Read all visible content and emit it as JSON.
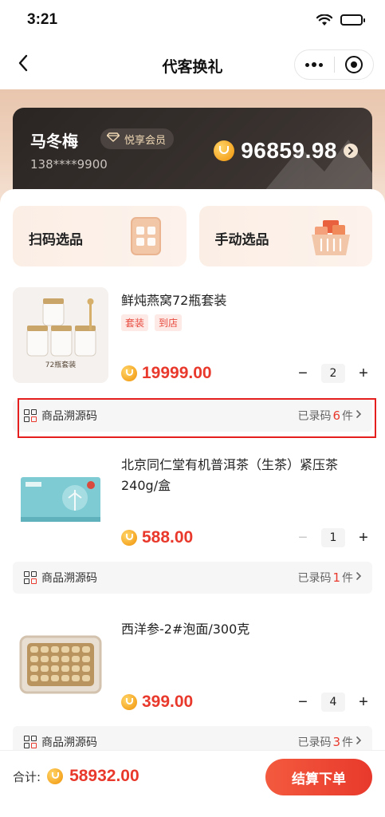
{
  "status_bar": {
    "time": "3:21"
  },
  "nav": {
    "title": "代客换礼"
  },
  "member": {
    "name": "马冬梅",
    "badge": "悦享会员",
    "phone": "138****9900",
    "balance": "96859.98"
  },
  "select_options": [
    {
      "label": "扫码选品",
      "icon": "scan-panel-icon"
    },
    {
      "label": "手动选品",
      "icon": "basket-icon"
    }
  ],
  "products": [
    {
      "name": "鲜炖燕窝72瓶套装",
      "tags": [
        "套装",
        "到店"
      ],
      "price": "19999.00",
      "quantity": "2",
      "thumb_caption": "72瓶套装",
      "trace_label": "商品溯源码",
      "trace_prefix": "已录码",
      "trace_count": "6",
      "trace_suffix": "件",
      "minus_disabled": false
    },
    {
      "name": "北京同仁堂有机普洱茶（生茶）紧压茶240g/盒",
      "tags": [],
      "price": "588.00",
      "quantity": "1",
      "trace_label": "商品溯源码",
      "trace_prefix": "已录码",
      "trace_count": "1",
      "trace_suffix": "件",
      "minus_disabled": true
    },
    {
      "name": "西洋参-2#泡面/300克",
      "tags": [],
      "price": "399.00",
      "quantity": "4",
      "trace_label": "商品溯源码",
      "trace_prefix": "已录码",
      "trace_count": "3",
      "trace_suffix": "件",
      "minus_disabled": false
    }
  ],
  "footer": {
    "total_label": "合计:",
    "total_value": "58932.00",
    "checkout_label": "结算下单"
  },
  "colors": {
    "accent_red": "#e8392c",
    "card_dark": "#2a2523",
    "warm_bg": "#fbeee5",
    "highlight_border": "#e51e1e"
  }
}
